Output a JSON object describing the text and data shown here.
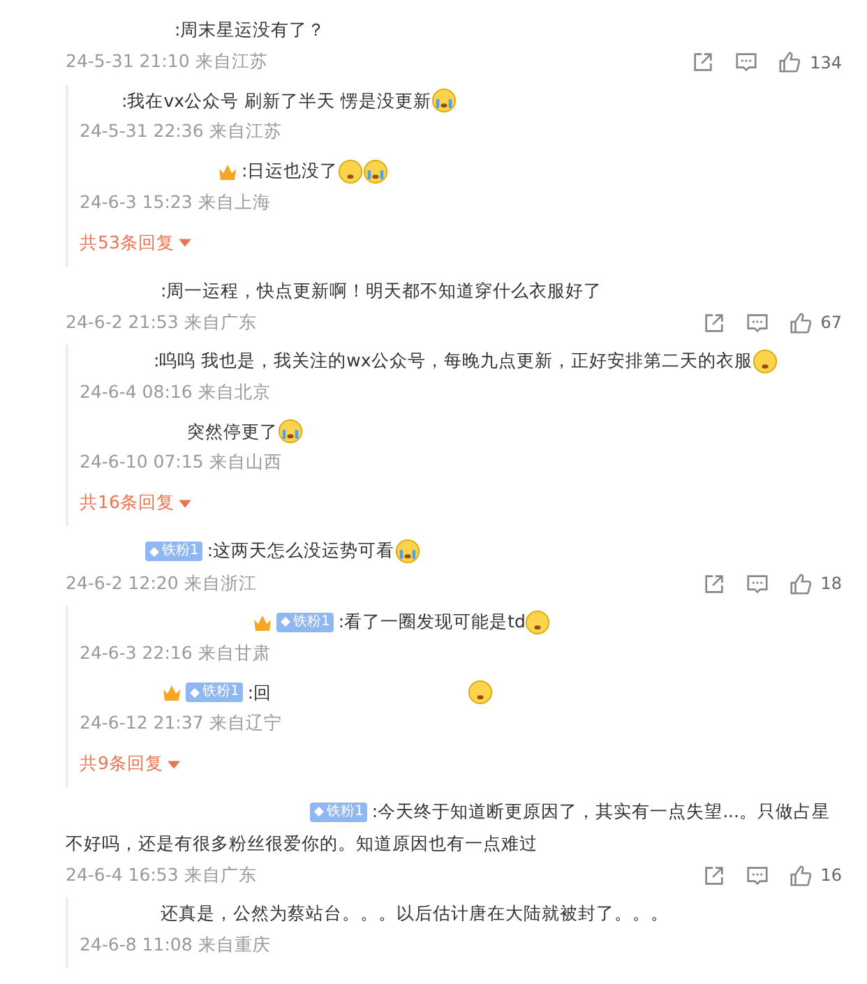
{
  "comments": [
    {
      "text": ":周末星运没有了？",
      "time": "24-5-31 21:10 来自江苏",
      "likes": "134",
      "replies": [
        {
          "text": ":我在vx公众号 刷新了半天 愣是没更新",
          "emojis": [
            {
              "kind": "crying"
            }
          ],
          "time": "24-5-31 22:36 来自江苏"
        },
        {
          "crown": true,
          "text": ":日运也没了",
          "emojis": [
            {
              "kind": "shy"
            },
            {
              "kind": "sobbing"
            }
          ],
          "time": "24-6-3 15:23 来自上海"
        }
      ],
      "more": "共53条回复"
    },
    {
      "text": ":周一运程，快点更新啊！明天都不知道穿什么衣服好了",
      "time": "24-6-2 21:53 来自广东",
      "likes": "67",
      "replies": [
        {
          "text": ":呜呜 我也是，我关注的wx公众号，每晚九点更新，正好安排第二天的衣服",
          "emojis": [
            {
              "kind": "pleading"
            }
          ],
          "time": "24-6-4 08:16 来自北京"
        },
        {
          "text": "突然停更了",
          "emojis": [
            {
              "kind": "sobbing"
            }
          ],
          "time": "24-6-10 07:15 来自山西"
        }
      ],
      "more": "共16条回复"
    },
    {
      "badge": "铁粉1",
      "text": ":这两天怎么没运势可看",
      "emojis": [
        {
          "kind": "sobbing"
        }
      ],
      "time": "24-6-2 12:20 来自浙江",
      "likes": "18",
      "replies": [
        {
          "crown": true,
          "badge": "铁粉1",
          "text": ":看了一圈发现可能是td",
          "emojis": [
            {
              "kind": "laughing"
            }
          ],
          "time": "24-6-3 22:16 来自甘肃"
        },
        {
          "crown": true,
          "badge": "铁粉1",
          "text": ":回",
          "gap": true,
          "emojis": [
            {
              "kind": "kiss"
            }
          ],
          "time": "24-6-12 21:37 来自辽宁"
        }
      ],
      "more": "共9条回复"
    },
    {
      "badge": "铁粉1",
      "text": ":今天终于知道断更原因了，其实有一点失望...。只做占星不好吗，还是有很多粉丝很爱你的。知道原因也有一点难过",
      "time": "24-6-4 16:53 来自广东",
      "likes": "16",
      "replies": [
        {
          "text": "还真是，公然为蔡站台。。。以后估计唐在大陆就被封了。。。",
          "time": "24-6-8 11:08 来自重庆"
        }
      ]
    }
  ]
}
